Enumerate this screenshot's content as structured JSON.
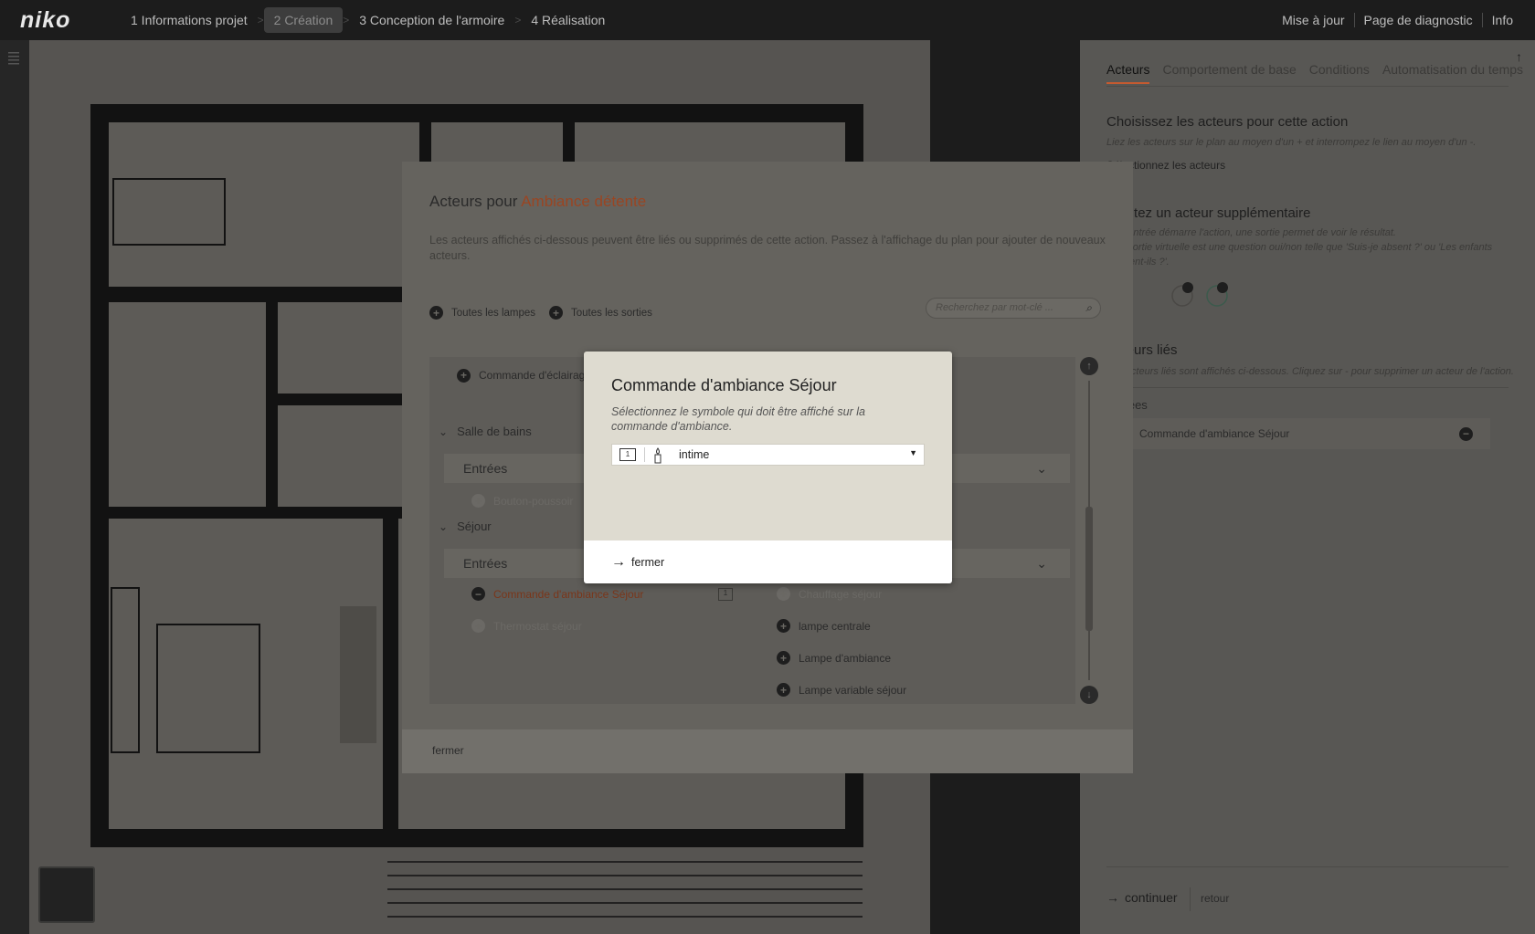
{
  "topbar": {
    "logo": "niko",
    "steps": [
      "1 Informations projet",
      "2 Création",
      "3 Conception de l'armoire",
      "4 Réalisation"
    ],
    "active_step": 1,
    "right_links": [
      "Mise à jour",
      "Page de diagnostic",
      "Info"
    ]
  },
  "right_panel": {
    "tabs": [
      "Acteurs",
      "Comportement de base",
      "Conditions",
      "Automatisation du temps"
    ],
    "choose_title": "Choisissez les acteurs pour cette action",
    "choose_sub": "Liez les acteurs sur le plan au moyen d'un + et interrompez le lien au moyen d'un -.",
    "select_link": "Sélectionnez les acteurs",
    "add_title": "Ajoutez un acteur supplémentaire",
    "add_sub_1": "Une entrée démarre l'action, une sortie permet de voir le résultat.",
    "add_sub_2": "Une sortie virtuelle est une question oui/non telle que 'Suis-je absent ?' ou 'Les enfants dorment-ils ?'.",
    "linked_title": "Acteurs liés",
    "linked_sub": "Les acteurs liés sont affichés ci-dessous. Cliquez sur - pour supprimer un acteur de l'action.",
    "inputs_label": "Entrées",
    "linked_item": "Commande d'ambiance Séjour",
    "continue": "continuer",
    "back": "retour"
  },
  "modal": {
    "title_prefix": "Acteurs pour",
    "title_highlight": "Ambiance détente",
    "description": "Les acteurs affichés ci-dessous peuvent être liés ou supprimés de cette action. Passez à l'affichage du plan pour ajouter de nouveaux acteurs.",
    "filter_all_lamps": "Toutes les lampes",
    "filter_all_outputs": "Toutes les sorties",
    "search_placeholder": "Recherchez par mot-clé ...",
    "row_command": "Commande d'éclairage",
    "room_bathroom": "Salle de bains",
    "inputs": "Entrées",
    "bath_button": "Bouton-poussoir",
    "room_living": "Séjour",
    "living_command": "Commande d'ambiance Séjour",
    "living_thermo": "Thermostat séjour",
    "out_heating": "Chauffage séjour",
    "out_lamp_central": "lampe centrale",
    "out_lamp_ambiance": "Lampe d'ambiance",
    "out_lamp_dim": "Lampe variable séjour",
    "close": "fermer"
  },
  "dialog": {
    "title": "Commande d'ambiance Séjour",
    "subtitle": "Sélectionnez le symbole qui doit être affiché sur la commande d'ambiance.",
    "selected_value": "intime",
    "close": "fermer"
  }
}
